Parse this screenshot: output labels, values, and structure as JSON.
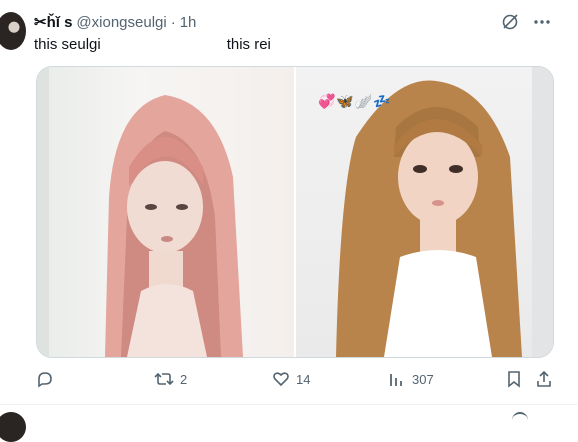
{
  "tweet": {
    "display_name": "✂ȟǐ s",
    "handle": "@xiongseulgi",
    "separator": "·",
    "time": "1h",
    "text_left": "this seulgi",
    "text_right": "this rei",
    "stickers": "💞🦋🪽💤",
    "icons": {
      "grok": "grok-icon",
      "more": "more-icon"
    },
    "stats": {
      "replies": "",
      "retweets": "2",
      "likes": "14",
      "views": "307"
    }
  },
  "colors": {
    "text": "#0f1419",
    "secondary": "#536471",
    "border": "#cfd9de"
  }
}
